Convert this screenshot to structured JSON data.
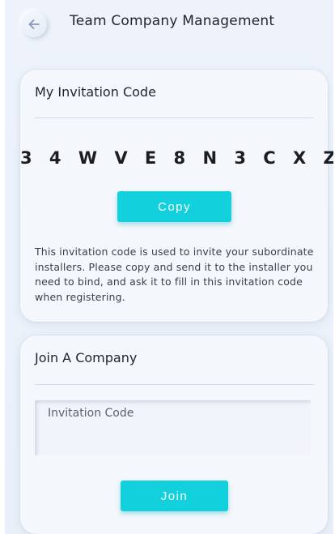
{
  "header": {
    "title": "Team Company Management",
    "back_icon": "arrow-left-icon"
  },
  "invitation_card": {
    "title": "My Invitation Code",
    "code": "3 4 W V E 8 N 3 C X Z",
    "copy_label": "Copy",
    "description": "This invitation code is used to invite your subordinate installers. Please copy and send it to the installer you need to bind, and ask it to fill in this invitation code when registering."
  },
  "join_card": {
    "title": "Join A Company",
    "input_placeholder": "Invitation Code",
    "input_value": "",
    "join_label": "Join"
  },
  "colors": {
    "accent": "#12d1dd",
    "background": "#eef3fb",
    "text": "#1f2430"
  }
}
